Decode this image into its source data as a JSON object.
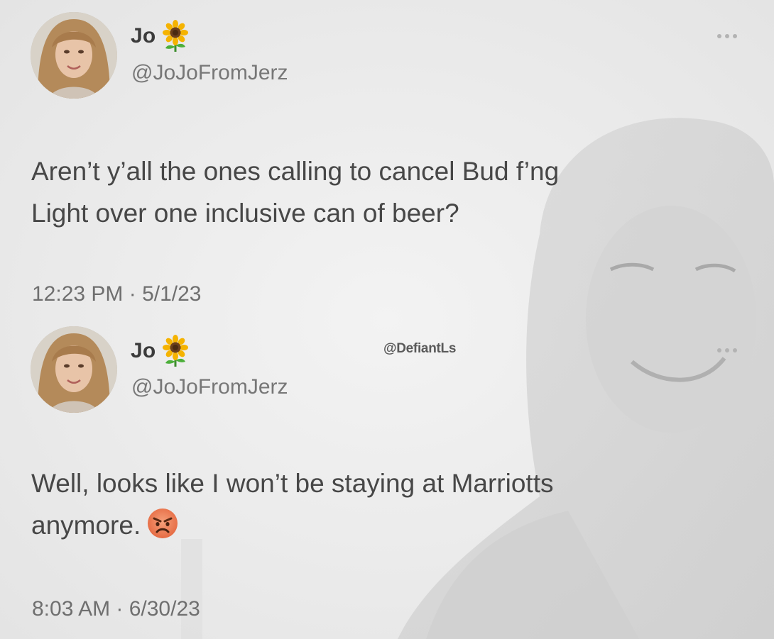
{
  "background": {
    "color": "#ececec"
  },
  "watermark": "@DefiantLs",
  "tweets": [
    {
      "name": "Jo",
      "name_emoji": "sunflower-icon",
      "handle": "@JoJoFromJerz",
      "text_line1": "Aren’t y’all the ones calling to cancel Bud f’ng",
      "text_line2": "Light over one inclusive can of beer?",
      "time": "12:23 PM · 5/1/23"
    },
    {
      "name": "Jo",
      "name_emoji": "sunflower-icon",
      "handle": "@JoJoFromJerz",
      "text_line1": "Well, looks like I won’t be staying at Marriotts",
      "text_line2": "anymore.",
      "text_emoji": "angry-face-icon",
      "time": "8:03 AM · 6/30/23"
    }
  ]
}
